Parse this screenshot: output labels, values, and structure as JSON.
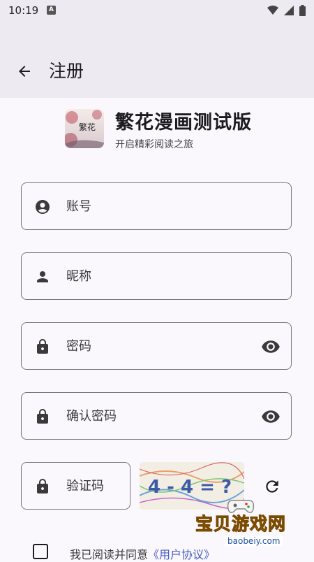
{
  "status_bar": {
    "time": "10:19",
    "notif_letter": "A"
  },
  "app_bar": {
    "title": "注册"
  },
  "brand": {
    "name": "繁花漫画测试版",
    "slogan": "开启精彩阅读之旅",
    "logo_text": "繁花"
  },
  "form": {
    "account_placeholder": "账号",
    "nickname_placeholder": "昵称",
    "password_placeholder": "密码",
    "confirm_password_placeholder": "确认密码",
    "captcha_placeholder": "验证码",
    "captcha_text": "4 - 4 = ?"
  },
  "agreement": {
    "prefix": "我已阅读并同意",
    "link": "《用户协议》"
  },
  "watermark": {
    "text": "宝贝游戏网",
    "url": "baobeiy.com"
  },
  "colors": {
    "app_bar_bg": "#edeaf2",
    "page_bg": "#fbf8fd",
    "link": "#4a5fc1",
    "outline": "#79747e"
  }
}
